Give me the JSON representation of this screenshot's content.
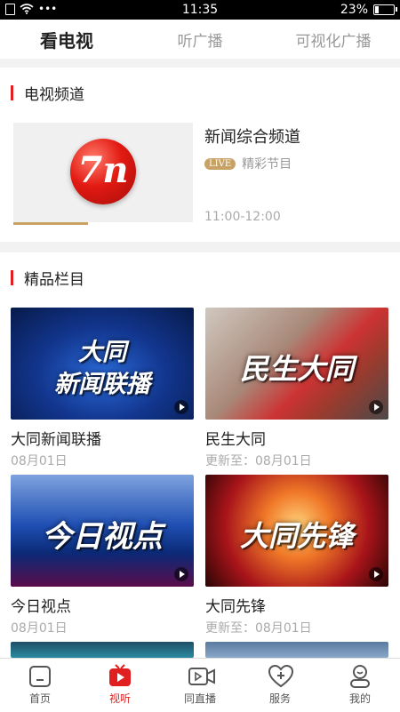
{
  "status": {
    "time": "11:35",
    "battery": "23%",
    "dots": "•••"
  },
  "tabs": [
    {
      "label": "看电视",
      "active": true
    },
    {
      "label": "听广播",
      "active": false
    },
    {
      "label": "可视化广播",
      "active": false
    }
  ],
  "tv_section": {
    "title": "电视频道",
    "channel": {
      "logo_text": "7n",
      "name": "新闻综合频道",
      "live_badge": "LIVE",
      "program": "精彩节目",
      "time": "11:00-12:00"
    }
  },
  "featured_section": {
    "title": "精品栏目",
    "items": [
      {
        "caption_line1": "大同",
        "caption_line2": "新闻联播",
        "title": "大同新闻联播",
        "date": "08月01日"
      },
      {
        "caption_line1": "民生大同",
        "caption_line2": "",
        "title": "民生大同",
        "date": "更新至：08月01日"
      },
      {
        "caption_line1": "今日视点",
        "caption_line2": "",
        "title": "今日视点",
        "date": "08月01日"
      },
      {
        "caption_line1": "大同先锋",
        "caption_line2": "",
        "title": "大同先锋",
        "date": "更新至：08月01日"
      }
    ]
  },
  "nav": [
    {
      "label": "首页",
      "icon": "home-icon",
      "active": false
    },
    {
      "label": "视听",
      "icon": "video-play-icon",
      "active": true
    },
    {
      "label": "同直播",
      "icon": "camera-icon",
      "active": false
    },
    {
      "label": "服务",
      "icon": "heart-plus-icon",
      "active": false
    },
    {
      "label": "我的",
      "icon": "user-icon",
      "active": false
    }
  ],
  "colors": {
    "accent": "#e02020",
    "gold": "#c8a265"
  }
}
